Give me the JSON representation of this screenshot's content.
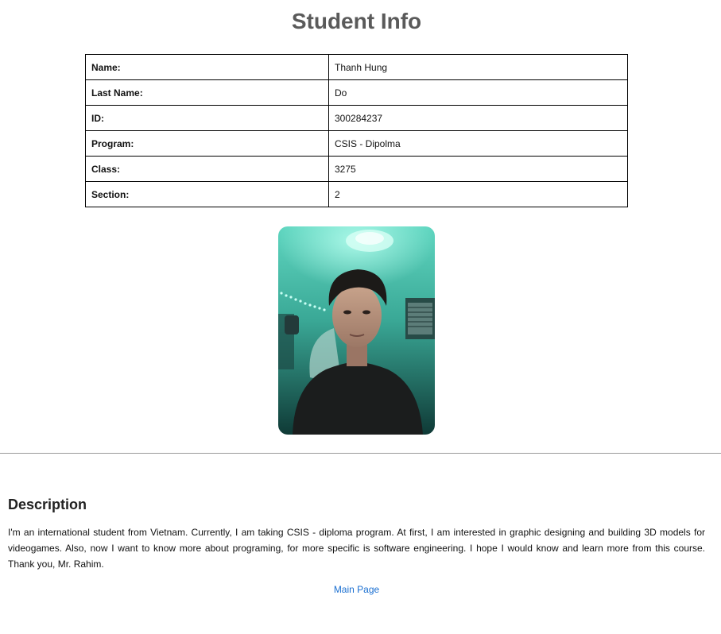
{
  "page": {
    "title": "Student Info"
  },
  "student_table": {
    "rows": [
      {
        "label": "Name:",
        "value": "Thanh Hung"
      },
      {
        "label": "Last Name:",
        "value": "Do"
      },
      {
        "label": "ID:",
        "value": "300284237"
      },
      {
        "label": "Program:",
        "value": "CSIS - Dipolma"
      },
      {
        "label": "Class:",
        "value": "3275"
      },
      {
        "label": "Section:",
        "value": "2"
      }
    ]
  },
  "description": {
    "heading": "Description",
    "text": "I'm an international student from Vietnam. Currently, I am taking CSIS - diploma program. At first, I am interested in graphic designing and building 3D models for videogames. Also, now I want to know more about programing, for more specific is software engineering. I hope I would know and learn more from this course. Thank you, Mr. Rahim."
  },
  "links": {
    "main_page": "Main Page"
  }
}
